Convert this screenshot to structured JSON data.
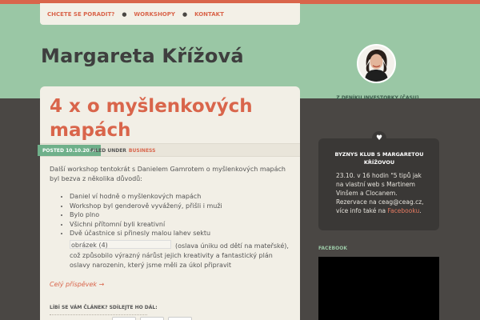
{
  "nav": {
    "items": [
      "CHCETE SE PORADIT?",
      "WORKSHOPY",
      "KONTAKT"
    ]
  },
  "site": {
    "title": "Margareta Křížová",
    "tagline": "Z DENÍKU INVESTORKY (ČASU)"
  },
  "post": {
    "title": "4 x o myšlenkových mapách",
    "posted_label": "POSTED",
    "posted_date": "10.10.2014",
    "filed_label": "FILED UNDER",
    "category": "BUSINESS",
    "intro": "Další workshop tentokrát s Danielem Gamrotem o myšlenkových mapách byl bezva z několika důvodů:",
    "bullets": [
      "Daniel ví hodně o myšlenkových mapách",
      "Workshop byl genderově vyvážený, přišli i muži",
      "Bylo plno",
      "Všichni přítomní byli kreativní",
      "Dvě účastnice si přinesly malou lahev sektu"
    ],
    "image_caption": "obrázek (4)",
    "after_image": "(oslava úniku od dětí na mateřské), což způsobilo výrazný nárůst jejich kreativity a fantastický plán oslavy narozenin, který jsme měli za úkol připravit",
    "read_more": "Celý příspěvek →",
    "share_label": "LÍBÍ SE VÁM ČLÁNEK? SDÍLEJTE HO DÁL:"
  },
  "sidebar": {
    "widget": {
      "title": "BYZNYS KLUB S MARGARETOU KŘÍŽOVOU",
      "text": "23.10. v 16 hodin \"5 tipů jak na vlastní web s Martinem Vinšem a Clocanem. Rezervace na ceag@ceag.cz, více info také na",
      "link": "Facebooku",
      "link_suffix": "."
    },
    "facebook_label": "FACEBOOK"
  },
  "colors": {
    "accent": "#d9654b",
    "header_green": "#9ac7a5",
    "posted_green": "#6fb08a",
    "dark_bg": "#4a4744"
  },
  "icons": {
    "widget_badge": "heart-icon"
  }
}
